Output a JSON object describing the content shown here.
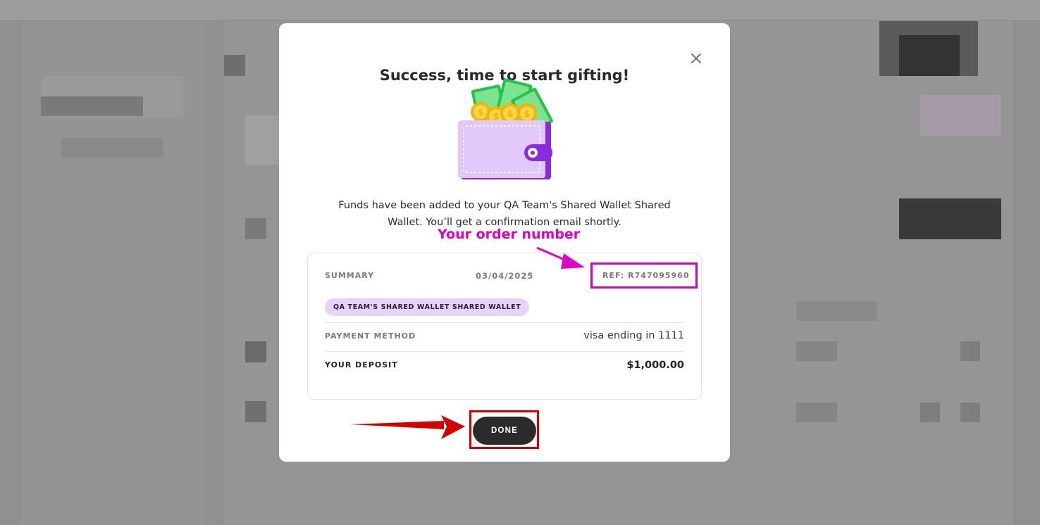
{
  "modal": {
    "title": "Success, time to start gifting!",
    "close_icon": "close-icon",
    "message_line1": "Funds have been added to your QA Team's Shared Wallet Shared",
    "message_line2": "Wallet. You’ll get a confirmation email shortly.",
    "summary": {
      "label": "SUMMARY",
      "date": "03/04/2025",
      "ref": "REF: R747095960",
      "wallet_chip": "QA TEAM'S SHARED WALLET SHARED WALLET",
      "payment_method_label": "PAYMENT METHOD",
      "payment_method_value": "visa ending in 1111",
      "deposit_label": "YOUR DEPOSIT",
      "deposit_value": "$1,000.00"
    },
    "done_label": "DONE"
  },
  "annotations": {
    "order_number_text": "Your order number",
    "colors": {
      "red": "#d40000",
      "magenta": "#e000c8"
    }
  },
  "colors": {
    "chip_bg": "#e7d3f7",
    "button_bg": "#2b2b2b",
    "wallet_purple": "#8a2be2"
  }
}
